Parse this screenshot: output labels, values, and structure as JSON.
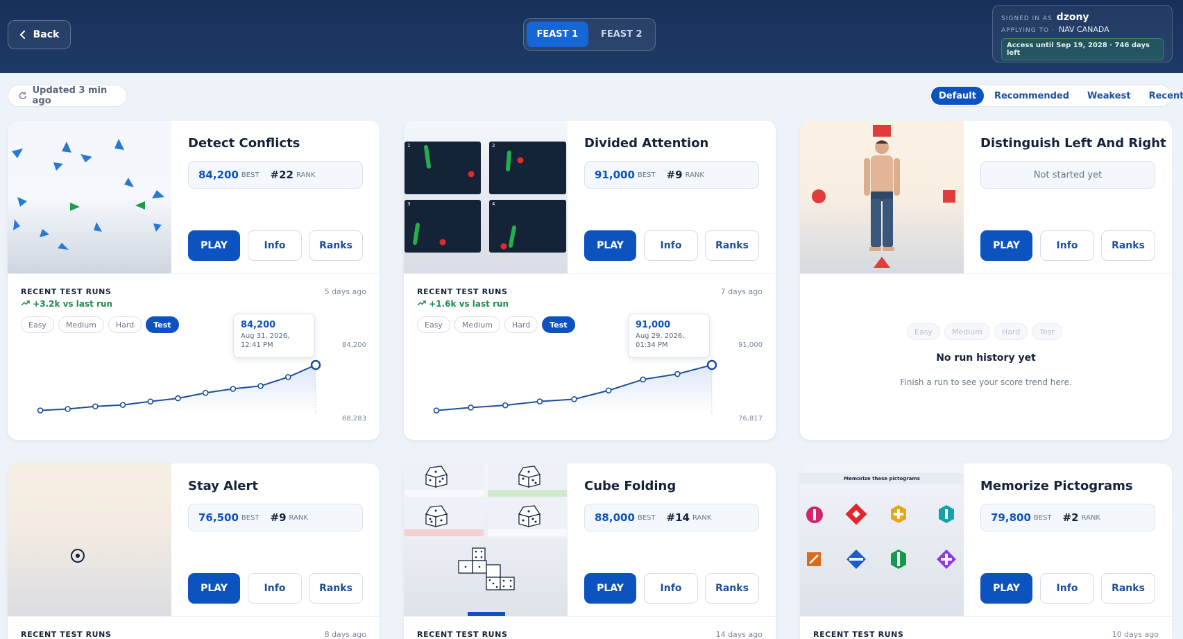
{
  "header": {
    "back_label": "Back",
    "tabs": [
      {
        "label": "FEAST 1",
        "active": true
      },
      {
        "label": "FEAST 2",
        "active": false
      }
    ],
    "user": {
      "signed_in_label": "SIGNED IN AS",
      "username": "dzony",
      "applying_label": "APPLYING TO ·",
      "organization": "NAV CANADA",
      "access_text": "Access until Sep 19, 2028  ·  746 days left"
    }
  },
  "toolbar": {
    "updated_text": "Updated 3 min ago",
    "sort_options": [
      {
        "label": "Default",
        "active": true
      },
      {
        "label": "Recommended",
        "active": false
      },
      {
        "label": "Weakest",
        "active": false
      },
      {
        "label": "Recent",
        "active": false
      }
    ]
  },
  "labels": {
    "best": "BEST",
    "rank": "RANK",
    "play": "PLAY",
    "info": "Info",
    "ranks": "Ranks",
    "recent_runs": "RECENT TEST RUNS",
    "difficulties": [
      "Easy",
      "Medium",
      "Hard",
      "Test"
    ],
    "not_started": "Not started yet",
    "no_history": "No run history yet",
    "no_history_hint": "Finish a run to see your score trend here."
  },
  "cards": [
    {
      "title": "Detect Conflicts",
      "best": "84,200",
      "rank": "#22",
      "last_run": "5 days ago",
      "delta": "+3.2k vs last run",
      "y_max_label": "84,200",
      "y_min_label": "68,283",
      "tooltip": {
        "value": "84,200",
        "date": "Aug 31, 2026,",
        "time": "12:41 PM"
      }
    },
    {
      "title": "Divided Attention",
      "best": "91,000",
      "rank": "#9",
      "last_run": "7 days ago",
      "delta": "+1.6k vs last run",
      "y_max_label": "91,000",
      "y_min_label": "76,817",
      "tooltip": {
        "value": "91,000",
        "date": "Aug 29, 2026,",
        "time": "01:34 PM"
      }
    },
    {
      "title": "Distinguish Left And Right"
    },
    {
      "title": "Stay Alert",
      "best": "76,500",
      "rank": "#9",
      "last_run": "8 days ago"
    },
    {
      "title": "Cube Folding",
      "best": "88,000",
      "rank": "#14",
      "last_run": "14 days ago"
    },
    {
      "title": "Memorize Pictograms",
      "best": "79,800",
      "rank": "#2",
      "last_run": "10 days ago",
      "thumb_caption": "Memorize these pictograms"
    }
  ],
  "chart_data": [
    {
      "type": "line",
      "title": "Detect Conflicts",
      "x": [
        1,
        2,
        3,
        4,
        5,
        6,
        7,
        8,
        9,
        10,
        11
      ],
      "values": [
        68400,
        68900,
        69800,
        70300,
        71500,
        72600,
        74500,
        75900,
        76900,
        80000,
        84200
      ],
      "ylim": [
        68283,
        84200
      ],
      "grid": false
    },
    {
      "type": "line",
      "title": "Divided Attention",
      "x": [
        1,
        2,
        3,
        4,
        5,
        6,
        7,
        8,
        9
      ],
      "values": [
        76900,
        77800,
        78500,
        79700,
        80400,
        83100,
        86500,
        88200,
        91000
      ],
      "ylim": [
        76817,
        91000
      ],
      "grid": false
    }
  ]
}
